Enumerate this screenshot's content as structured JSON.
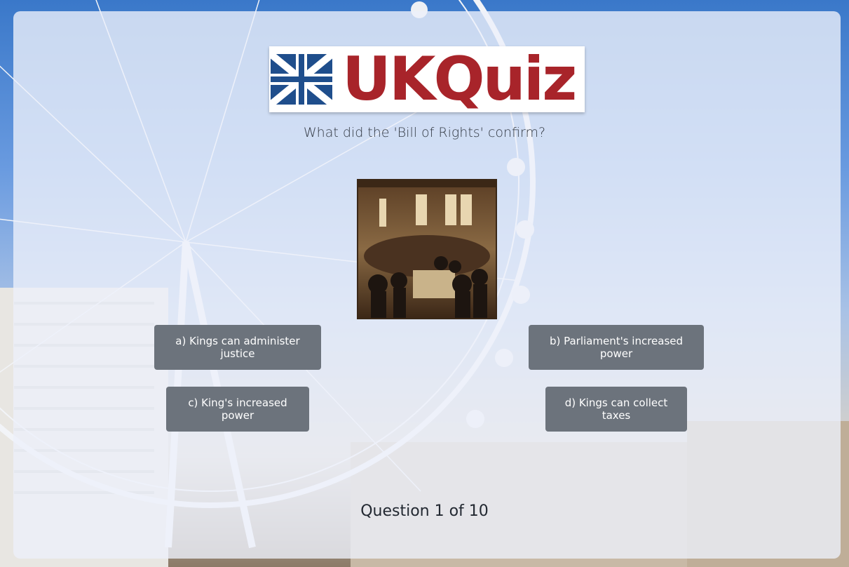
{
  "logo": {
    "text": "UKQuiz",
    "flag_icon": "union-jack-icon",
    "brand_color": "#a8242a",
    "flag_color": "#1f4e8c"
  },
  "question": {
    "text": "What did the 'Bill of Rights' confirm?",
    "image_icon": "bill-of-rights-painting"
  },
  "answers": [
    {
      "label": "a) Kings can administer justice"
    },
    {
      "label": "b) Parliament's increased power"
    },
    {
      "label": "c) King's increased power"
    },
    {
      "label": "d) Kings can collect taxes"
    }
  ],
  "progress": {
    "text": "Question 1 of 10"
  },
  "colors": {
    "button_bg": "#6c737c",
    "button_text": "#ffffff",
    "panel_bg": "rgba(236,240,250,0.80)"
  }
}
